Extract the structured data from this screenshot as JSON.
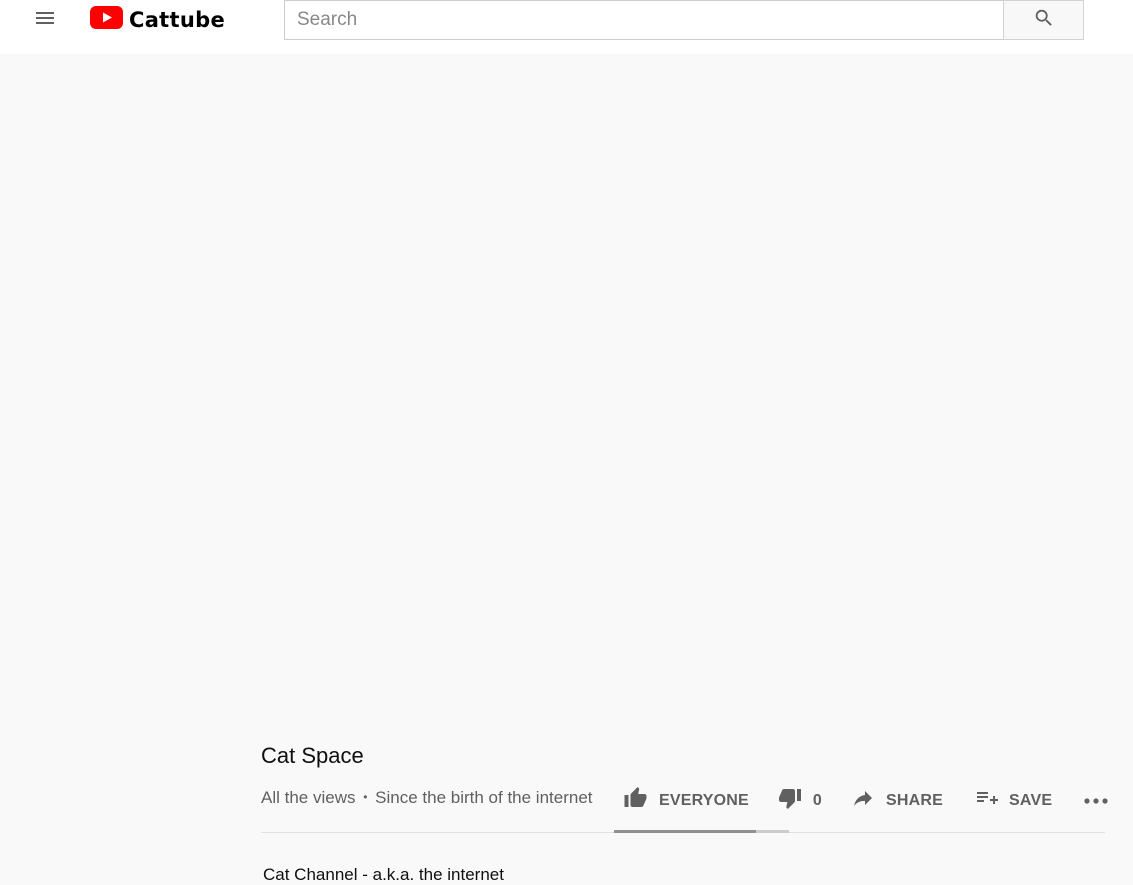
{
  "header": {
    "brand": "Cattube",
    "search_placeholder": "Search",
    "search_value": ""
  },
  "icons": {
    "menu": "hamburger-menu-icon",
    "logo": "play-button-logo-icon",
    "search": "magnifier-search-icon",
    "like": "thumbs-up-icon",
    "dislike": "thumbs-down-icon",
    "share": "share-arrow-icon",
    "save": "playlist-add-icon",
    "more": "more-horizontal-icon"
  },
  "colors": {
    "brand_red": "#ff0000",
    "page_background": "#f9f9f9",
    "secondary_text": "#606060"
  },
  "video": {
    "title": "Cat Space",
    "views": "All the views",
    "separator": "•",
    "date": "Since the birth of the internet",
    "like_label": "EVERYONE",
    "dislike_count": "0",
    "share_label": "SHARE",
    "save_label": "SAVE",
    "like_ratio": 0.81
  },
  "channel": {
    "name": "Cat Channel - a.k.a. the internet"
  }
}
